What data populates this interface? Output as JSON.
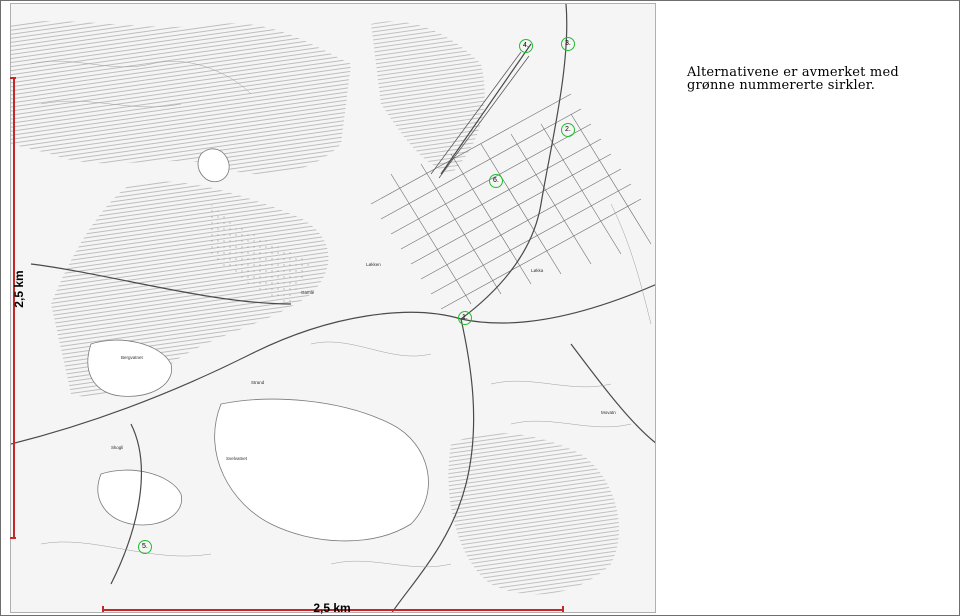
{
  "caption": "Alternativene er avmerket med grønne nummererte sirkler.",
  "scale": {
    "vertical_label": "2,5 km",
    "horizontal_label": "2,5 km",
    "color": "#c62828"
  },
  "markers": {
    "color": "#1fbf2f",
    "items": [
      {
        "label": "1."
      },
      {
        "label": "2."
      },
      {
        "label": "3."
      },
      {
        "label": "4."
      },
      {
        "label": "5."
      },
      {
        "label": "6."
      }
    ]
  }
}
